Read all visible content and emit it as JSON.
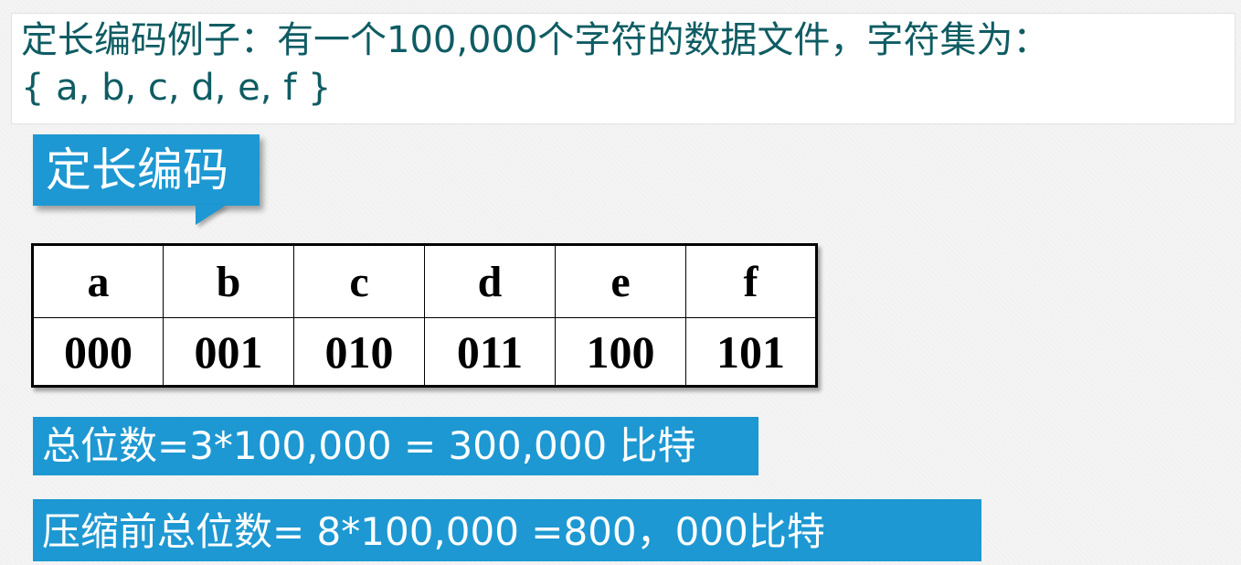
{
  "header": {
    "line1": "定长编码例子：有一个100,000个字符的数据文件，字符集为：",
    "line2": "{ a, b, c, d, e, f }"
  },
  "callout": {
    "label": "定长编码"
  },
  "table": {
    "chars": [
      "a",
      "b",
      "c",
      "d",
      "e",
      "f"
    ],
    "codes": [
      "000",
      "001",
      "010",
      "011",
      "100",
      "101"
    ]
  },
  "total_bits": "总位数=3*100,000 = 300,000 比特",
  "before_compress": "压缩前总位数= 8*100,000 =800，000比特",
  "colors": {
    "accent": "#1d98d2",
    "header_text": "#0f5c63"
  }
}
